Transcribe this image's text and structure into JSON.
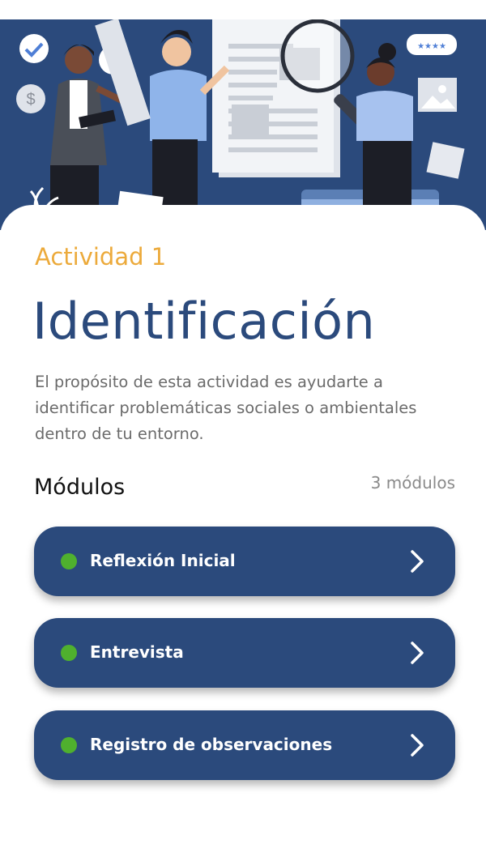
{
  "colors": {
    "primary": "#2b4a7c",
    "accent": "#ecaa3b",
    "status_dot": "#4fb02e"
  },
  "activity": {
    "label": "Actividad 1",
    "title": "Identificación",
    "description": "El propósito de esta actividad es ayudarte a identificar problemáticas sociales o ambientales dentro de tu entorno."
  },
  "modules": {
    "heading": "Módulos",
    "count_label": "3 módulos",
    "items": [
      {
        "label": "Reflexión Inicial",
        "icon": "chevron-right-icon"
      },
      {
        "label": "Entrevista",
        "icon": "chevron-right-icon"
      },
      {
        "label": "Registro de observaciones",
        "icon": "chevron-right-icon"
      }
    ]
  },
  "hero": {
    "illustration": "people-reviewing-documents-illustration",
    "rating_stars": "★★★★"
  }
}
